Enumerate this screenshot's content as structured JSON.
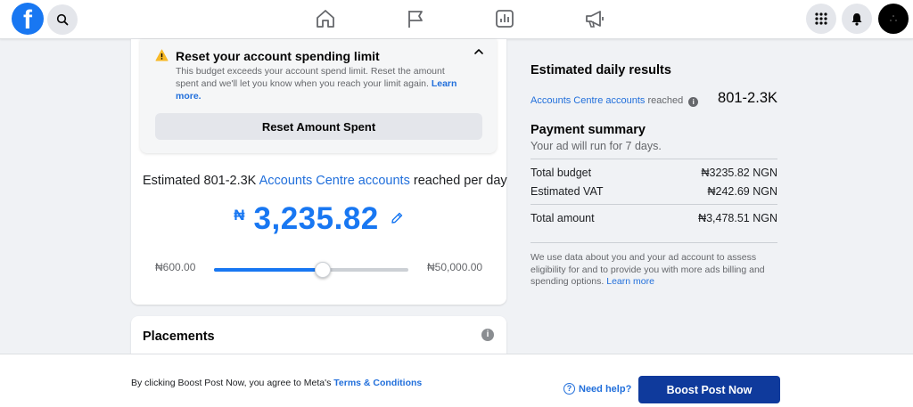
{
  "nav": {
    "logo_letter": "f",
    "icons": [
      "search-icon",
      "home-icon",
      "flag-icon",
      "insights-icon",
      "megaphone-icon",
      "menu-grid-icon",
      "notifications-icon",
      "avatar"
    ]
  },
  "alert": {
    "title": "Reset your account spending limit",
    "body": "This budget exceeds your account spend limit. Reset the amount spent and we'll let you know when you reach your limit again.",
    "link": "Learn more.",
    "button": "Reset Amount Spent"
  },
  "estimate": {
    "prefix": "Estimated 801-2.3K ",
    "link": "Accounts Centre accounts",
    "suffix": " reached per day"
  },
  "budget": {
    "currency": "₦",
    "amount": "3,235.82"
  },
  "slider": {
    "min_label": "₦600.00",
    "max_label": "₦50,000.00",
    "position": 0.56
  },
  "placements": {
    "title": "Placements",
    "info_glyph": "i"
  },
  "results": {
    "title": "Estimated daily results",
    "reach_link": "Accounts Centre accounts",
    "reach_suffix": " reached",
    "info_glyph": "i",
    "reach_value": "801-2.3K"
  },
  "payment": {
    "title": "Payment summary",
    "subtitle": "Your ad will run for 7 days.",
    "rows": [
      {
        "label": "Total budget",
        "value": "₦3235.82 NGN"
      },
      {
        "label": "Estimated VAT",
        "value": "₦242.69 NGN"
      },
      {
        "label": "Total amount",
        "value": "₦3,478.51 NGN"
      }
    ],
    "note": "We use data about you and your ad account to assess eligibility for and to provide you with more ads billing and spending options. ",
    "note_link": "Learn more"
  },
  "footer": {
    "terms_prefix": "By clicking Boost Post Now, you agree to Meta's ",
    "terms_link": "Terms & Conditions",
    "help_glyph": "?",
    "help": "Need help?",
    "boost_button": "Boost Post Now"
  },
  "colors": {
    "brand_blue": "#1877f2",
    "link_blue": "#216fdb",
    "boost_button": "#0f3a9c",
    "warning": "#f7b928"
  }
}
